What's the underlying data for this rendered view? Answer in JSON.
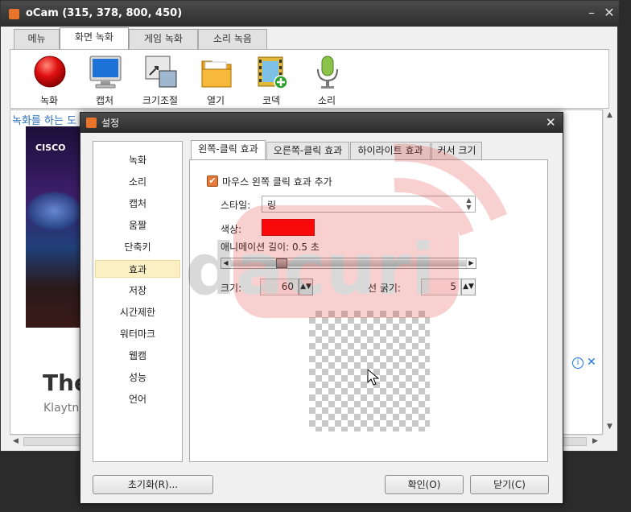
{
  "main_window": {
    "title": "oCam (315, 378, 800, 450)",
    "minimize": "–",
    "close": "✕",
    "tabs": [
      "메뉴",
      "화면 녹화",
      "게임 녹화",
      "소리 녹음"
    ],
    "tools": [
      {
        "label": "녹화",
        "icon": "record-icon"
      },
      {
        "label": "캡처",
        "icon": "monitor-icon"
      },
      {
        "label": "크기조절",
        "icon": "resize-icon"
      },
      {
        "label": "열기",
        "icon": "folder-icon"
      },
      {
        "label": "코덱",
        "icon": "codec-film-icon"
      },
      {
        "label": "소리",
        "icon": "microphone-icon"
      }
    ],
    "content": {
      "link_text": "녹화를 하는 도",
      "ad_brand": "CISCO",
      "ad_headline": "The",
      "ad_subtext": "Klaytn"
    }
  },
  "dialog": {
    "title": "설정",
    "close": "✕",
    "categories": [
      "녹화",
      "소리",
      "캡처",
      "움짤",
      "단축키",
      "효과",
      "저장",
      "시간제한",
      "워터마크",
      "웹캠",
      "성능",
      "언어"
    ],
    "selected_category": "효과",
    "tabs": [
      "왼쪽-클릭 효과",
      "오른쪽-클릭 효과",
      "하이라이트 효과",
      "커서 크기"
    ],
    "left_click": {
      "checkbox_label": "마우스 왼쪽 클릭 효과 추가",
      "checked": true,
      "style_label": "스타일:",
      "style_value": "링",
      "color_label": "색상:",
      "color_value": "#ff0000",
      "anim_label": "애니메이션 길이: 0.5 초",
      "anim_slider_fraction": 0.2,
      "size_label": "크기:",
      "size_value": "60",
      "line_label": "선 굵기:",
      "line_value": "5"
    },
    "buttons": {
      "reset": "초기화(R)...",
      "ok": "확인(O)",
      "close": "닫기(C)"
    }
  },
  "watermark_text": "dacuri"
}
